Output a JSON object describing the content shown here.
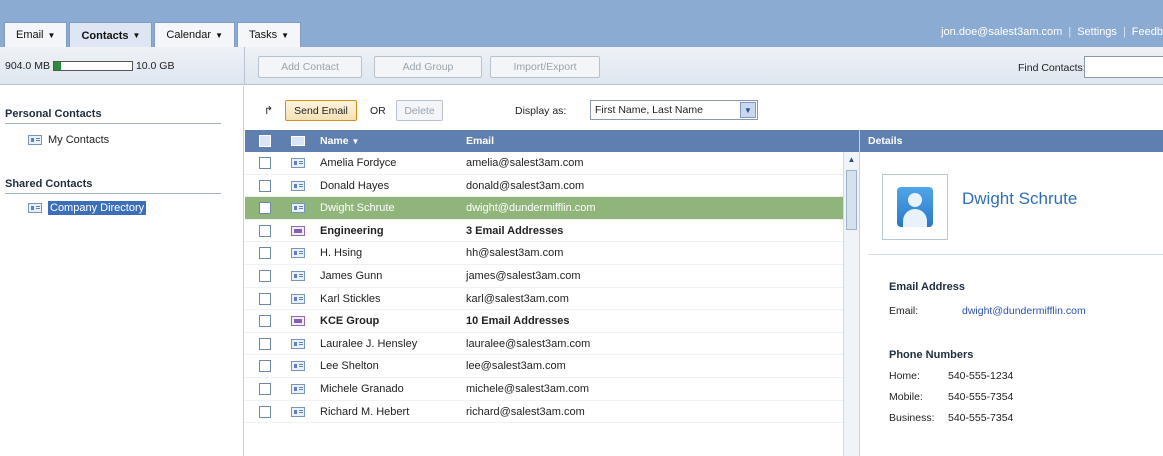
{
  "tabs": [
    {
      "label": "Email"
    },
    {
      "label": "Contacts"
    },
    {
      "label": "Calendar"
    },
    {
      "label": "Tasks"
    }
  ],
  "account": {
    "user": "jon.doe@salest3am.com",
    "separator": "|",
    "settings": "Settings",
    "feedback": "Feedb"
  },
  "quota": {
    "used": "904.0 MB",
    "total": "10.0 GB",
    "fill_fraction": 0.09,
    "fill_color": "#2e8b3a"
  },
  "toolbar": {
    "add_contact": "Add Contact",
    "add_group": "Add Group",
    "import_export": "Import/Export",
    "find_label": "Find Contacts:",
    "find_value": ""
  },
  "sidebar": {
    "personal_title": "Personal Contacts",
    "personal_items": [
      {
        "label": "My Contacts",
        "icon": "contact-card-icon"
      }
    ],
    "shared_title": "Shared Contacts",
    "shared_items": [
      {
        "label": "Company Directory",
        "icon": "contact-card-icon",
        "selected": true
      }
    ]
  },
  "actions": {
    "reply_icon": "↱",
    "send_email": "Send Email",
    "or": "OR",
    "delete": "Delete",
    "display_as_label": "Display as:",
    "display_as_value": "First Name, Last Name"
  },
  "list": {
    "col_name": "Name",
    "col_email": "Email",
    "rows": [
      {
        "name": "Amelia Fordyce",
        "email": "amelia@salest3am.com",
        "type": "contact"
      },
      {
        "name": "Donald Hayes",
        "email": "donald@salest3am.com",
        "type": "contact"
      },
      {
        "name": "Dwight Schrute",
        "email": "dwight@dundermifflin.com",
        "type": "contact",
        "selected": true
      },
      {
        "name": "Engineering",
        "email": "3 Email Addresses",
        "type": "group"
      },
      {
        "name": "H. Hsing",
        "email": "hh@salest3am.com",
        "type": "contact"
      },
      {
        "name": "James Gunn",
        "email": "james@salest3am.com",
        "type": "contact"
      },
      {
        "name": "Karl Stickles",
        "email": "karl@salest3am.com",
        "type": "contact"
      },
      {
        "name": "KCE Group",
        "email": "10 Email Addresses",
        "type": "group"
      },
      {
        "name": "Lauralee J. Hensley",
        "email": "lauralee@salest3am.com",
        "type": "contact"
      },
      {
        "name": "Lee Shelton",
        "email": "lee@salest3am.com",
        "type": "contact"
      },
      {
        "name": "Michele Granado",
        "email": "michele@salest3am.com",
        "type": "contact"
      },
      {
        "name": "Richard M. Hebert",
        "email": "richard@salest3am.com",
        "type": "contact"
      }
    ]
  },
  "details": {
    "header": "Details",
    "name": "Dwight Schrute",
    "email_section": "Email Address",
    "email_label": "Email:",
    "email_value": "dwight@dundermifflin.com",
    "phone_section": "Phone Numbers",
    "phones": [
      {
        "label": "Home:",
        "value": "540-555-1234"
      },
      {
        "label": "Mobile:",
        "value": "540-555-7354"
      },
      {
        "label": "Business:",
        "value": "540-555-7354"
      }
    ]
  },
  "colors": {
    "header_blue": "#8cabd2",
    "column_header": "#5f7fb0",
    "selected_row": "#8fb57a",
    "accent_orange": "#d49018",
    "link_blue": "#2f6fb8"
  }
}
